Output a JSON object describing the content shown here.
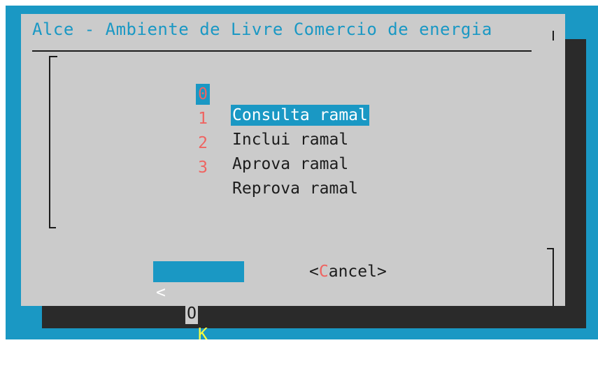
{
  "dialog": {
    "title": "Alce - Ambiente de Livre Comercio de energia"
  },
  "menu": {
    "items": [
      {
        "key": "0",
        "label": "Consulta ramal",
        "selected": true
      },
      {
        "key": "1",
        "label": "Inclui ramal",
        "selected": false
      },
      {
        "key": "2",
        "label": "Aprova ramal",
        "selected": false
      },
      {
        "key": "3",
        "label": "Reprova ramal",
        "selected": false
      }
    ]
  },
  "buttons": {
    "ok": {
      "left": "<",
      "hotkey_prefix": "O",
      "hotkey": "K",
      "right": ">"
    },
    "cancel": {
      "open": "<",
      "hotkey": "C",
      "rest": "ancel",
      "close": ">"
    }
  },
  "colors": {
    "background": "#1a98c4",
    "dialog": "#cbcbcb",
    "shadow": "#2a2a2a",
    "hotkey": "#ef6461",
    "selection": "#1a98c4",
    "ok_hotkey": "#ffff3a"
  }
}
